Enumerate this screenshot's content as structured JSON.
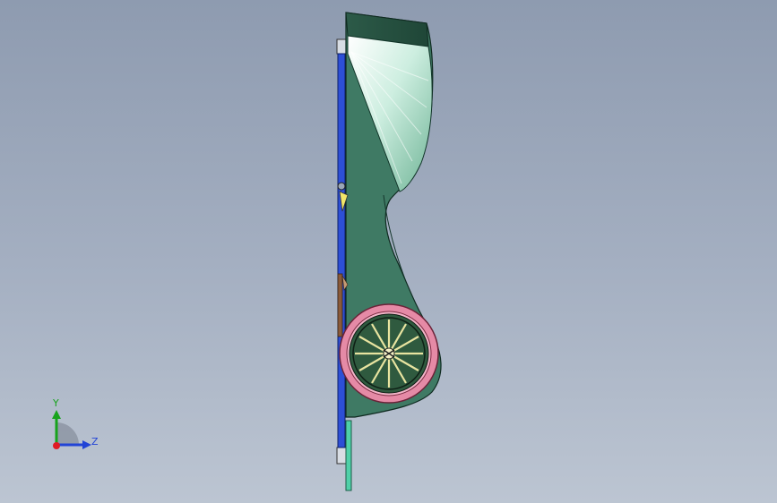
{
  "viewport": {
    "background_top": "#8e9bb0",
    "background_bottom": "#bcc5d2"
  },
  "model": {
    "body_color": "#3f7a64",
    "canopy_color": "#cdeee0",
    "rail_color": "#2d4fd6",
    "wheel_tire_color": "#e58aa6",
    "wheel_hub_color": "#2f5a3f",
    "spoke_color": "#e8e4a0"
  },
  "triad": {
    "y_label": "Y",
    "z_label": "Z",
    "y_color": "#17a31c",
    "z_color": "#2244d6",
    "x_color": "#e01b24"
  }
}
